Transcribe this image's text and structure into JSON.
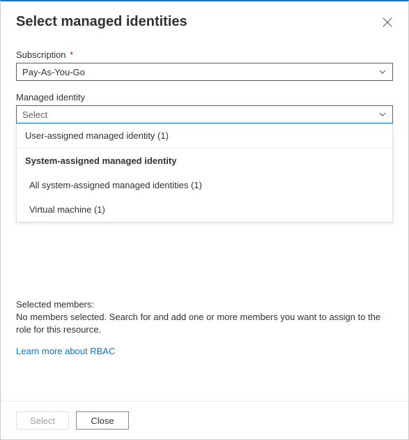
{
  "header": {
    "title": "Select managed identities"
  },
  "subscription": {
    "label": "Subscription",
    "required_marker": "*",
    "value": "Pay-As-You-Go"
  },
  "managed_identity": {
    "label": "Managed identity",
    "placeholder": "Select",
    "dropdown": {
      "user_assigned": "User-assigned managed identity (1)",
      "system_header": "System-assigned managed identity",
      "all_system": "All system-assigned managed identities (1)",
      "vm": "Virtual machine (1)"
    }
  },
  "selected": {
    "title": "Selected members:",
    "description": "No members selected. Search for and add one or more members you want to assign to the role for this resource."
  },
  "link": {
    "rbac": "Learn more about RBAC"
  },
  "footer": {
    "select": "Select",
    "close": "Close"
  }
}
